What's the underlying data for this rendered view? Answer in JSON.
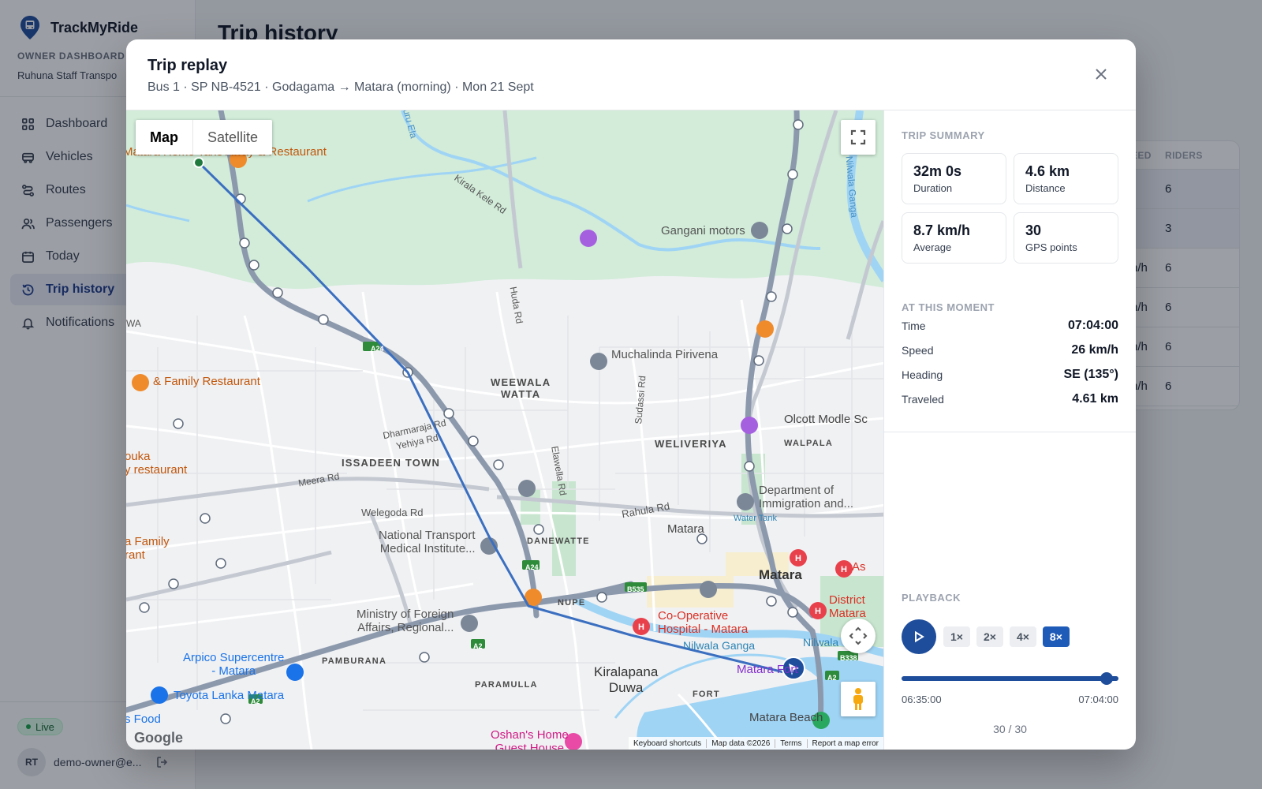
{
  "app": {
    "name": "TrackMyRide",
    "section_label": "OWNER DASHBOARD",
    "org_name": "Ruhuna Staff Transpo",
    "page_title": "Trip history",
    "nav": [
      {
        "label": "Dashboard",
        "icon": "grid-icon"
      },
      {
        "label": "Vehicles",
        "icon": "bus-icon"
      },
      {
        "label": "Routes",
        "icon": "route-icon"
      },
      {
        "label": "Passengers",
        "icon": "users-icon"
      },
      {
        "label": "Today",
        "icon": "calendar-icon"
      },
      {
        "label": "Trip history",
        "icon": "history-icon",
        "active": true
      },
      {
        "label": "Notifications",
        "icon": "bell-icon"
      }
    ],
    "live_label": "Live",
    "user_initials": "RT",
    "user_email": "demo-owner@e..."
  },
  "table": {
    "headers": {
      "speed": "EED",
      "riders": "RIDERS"
    },
    "rows": [
      {
        "speed": "",
        "riders": "6"
      },
      {
        "speed": "",
        "riders": "3"
      },
      {
        "speed": "n/h",
        "riders": "6"
      },
      {
        "speed": "n/h",
        "riders": "6"
      },
      {
        "speed": "n/h",
        "riders": "6"
      },
      {
        "speed": "n/h",
        "riders": "6"
      }
    ]
  },
  "modal": {
    "title": "Trip replay",
    "subtitle": "Bus 1 · SP NB-4521 · Godagama → Matara (morning) · Mon 21 Sept"
  },
  "map": {
    "type_map": "Map",
    "type_satellite": "Satellite",
    "footer": {
      "shortcuts": "Keyboard shortcuts",
      "data": "Map data ©2026",
      "terms": "Terms",
      "report": "Report a map error"
    },
    "logo": "Google",
    "labels": {
      "gangani": "Gangani motors",
      "muchalinda": "Muchalinda Pirivena",
      "weewala": "WEEWALA\nWATTA",
      "weliveriya": "WELIVERIYA",
      "walpala": "WALPALA",
      "issadeen": "ISSADEEN TOWN",
      "olcott": "Olcott Modle Sc",
      "immigration": "Department of\nImmigration and...",
      "water_tank": "Water Tank",
      "matara_city": "Matara",
      "matara_station": "Matara",
      "family_restaurant": "& Family Restaurant",
      "matara_remo": "Matara Remo Take\nAway & Restaurant",
      "puka": "ouka\ny restaurant",
      "family2": "a Family\nrant",
      "nti": "National Transport\nMedical Institute...",
      "danewatte": "DANEWATTE",
      "nupe": "NUPE",
      "ministry": "Ministry of Foreign\nAffairs, Regional...",
      "coop": "Co-Operative\nHospital - Matara",
      "district": "District\nMatara",
      "as": "As",
      "arpico": "Arpico Supercentre\n- Matara",
      "toyota": "Toyota Lanka Matara",
      "pamburana": "PAMBURANA",
      "paramulla": "PARAMULLA",
      "kiralapana": "Kiralapana\nDuwa",
      "fort": "FORT",
      "matara_fort": "Matara Fort",
      "matara_beach": "Matara Beach",
      "nilwala": "Nilwala Ganga",
      "nilwala2": "Nilwala",
      "oshan": "Oshan's Home\nGuest House",
      "food": "s Food",
      "wa": "WA",
      "kirala_kele": "Kirala Kele Rd",
      "huda": "Huda Rd",
      "sudassi": "Sudassi Rd",
      "elawella": "Elawella Rd",
      "dharmaraja": "Dharmaraja Rd",
      "yehiya": "Yehiya Rd",
      "meera": "Meera Rd",
      "welegoda": "Welegoda Rd",
      "rahula": "Rahula Rd",
      "uru_ela": "uru Ela",
      "nilwala_ganga_v": "Nilwala Ganga",
      "a24": "A24",
      "a24b": "A24",
      "a2": "A2",
      "a2b": "A2",
      "a2c": "A2",
      "b535": "B535",
      "b338": "B338"
    }
  },
  "summary": {
    "section": "TRIP SUMMARY",
    "stats": [
      {
        "value": "32m 0s",
        "label": "Duration"
      },
      {
        "value": "4.6 km",
        "label": "Distance"
      },
      {
        "value": "8.7 km/h",
        "label": "Average"
      },
      {
        "value": "30",
        "label": "GPS points"
      }
    ]
  },
  "moment": {
    "section": "AT THIS MOMENT",
    "rows": [
      {
        "key": "Time",
        "value": "07:04:00"
      },
      {
        "key": "Speed",
        "value": "26 km/h"
      },
      {
        "key": "Heading",
        "value": "SE (135°)"
      },
      {
        "key": "Traveled",
        "value": "4.61 km"
      }
    ]
  },
  "playback": {
    "section": "PLAYBACK",
    "speeds": [
      "1×",
      "2×",
      "4×",
      "8×"
    ],
    "selected_speed": "8×",
    "progress": 1.0,
    "start_time": "06:35:00",
    "end_time": "07:04:00",
    "counter": "30 / 30"
  },
  "colors": {
    "accent": "#1e4d9b",
    "route": "#3b6fc0",
    "active_nav_bg": "#e8edf6"
  }
}
